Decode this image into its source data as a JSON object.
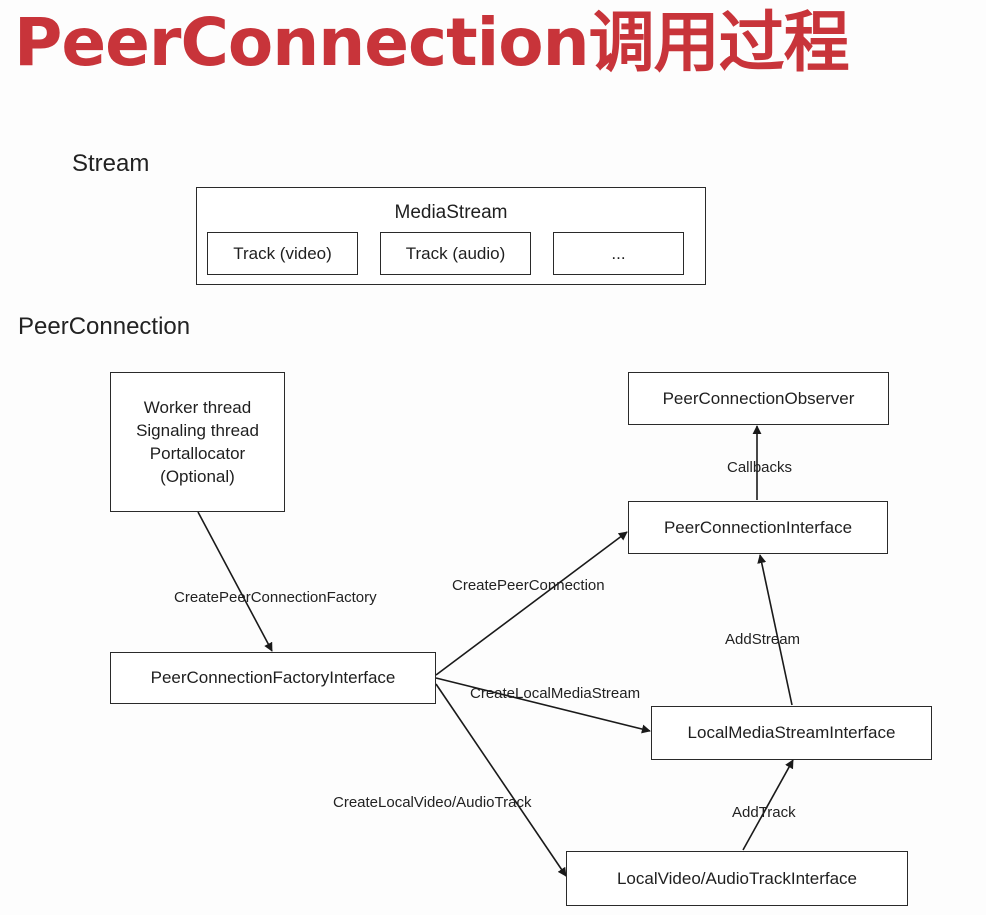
{
  "title": "PeerConnection调用过程",
  "sections": {
    "stream": "Stream",
    "peerconnection": "PeerConnection"
  },
  "media_stream": {
    "label": "MediaStream",
    "tracks": [
      "Track (video)",
      "Track (audio)",
      "..."
    ]
  },
  "nodes": {
    "threads": [
      "Worker thread",
      "Signaling thread",
      "Portallocator",
      "(Optional)"
    ],
    "factory": "PeerConnectionFactoryInterface",
    "observer": "PeerConnectionObserver",
    "pc_interface": "PeerConnectionInterface",
    "local_stream": "LocalMediaStreamInterface",
    "local_track": "LocalVideo/AudioTrackInterface"
  },
  "edges": {
    "create_factory": "CreatePeerConnectionFactory",
    "create_pc": "CreatePeerConnection",
    "create_stream": "CreateLocalMediaStream",
    "create_track": "CreateLocalVideo/AudioTrack",
    "callbacks": "Callbacks",
    "add_stream": "AddStream",
    "add_track": "AddTrack"
  }
}
